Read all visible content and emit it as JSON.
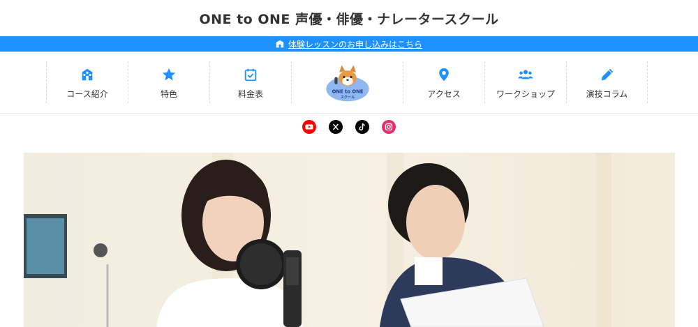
{
  "site": {
    "title": "ONE to ONE 声優・俳優・ナレータースクール"
  },
  "trial_bar": {
    "link_text": "体験レッスンのお申し込みはこちら"
  },
  "nav": {
    "items": [
      {
        "label": "コース紹介",
        "icon": "school-icon"
      },
      {
        "label": "特色",
        "icon": "star-icon"
      },
      {
        "label": "料金表",
        "icon": "calendar-check-icon"
      },
      {
        "label": "アクセス",
        "icon": "map-pin-icon"
      },
      {
        "label": "ワークショップ",
        "icon": "users-icon"
      },
      {
        "label": "演技コラム",
        "icon": "pencil-icon"
      }
    ],
    "logo": {
      "line1": "ONE to ONE",
      "line2": "スクール"
    }
  },
  "social": {
    "items": [
      {
        "name": "youtube",
        "color": "#ff0000"
      },
      {
        "name": "x",
        "color": "#000000"
      },
      {
        "name": "tiktok",
        "color": "#000000"
      },
      {
        "name": "instagram",
        "color": "#e1306c"
      }
    ]
  },
  "colors": {
    "accent": "#1e90ff",
    "text": "#333333"
  }
}
